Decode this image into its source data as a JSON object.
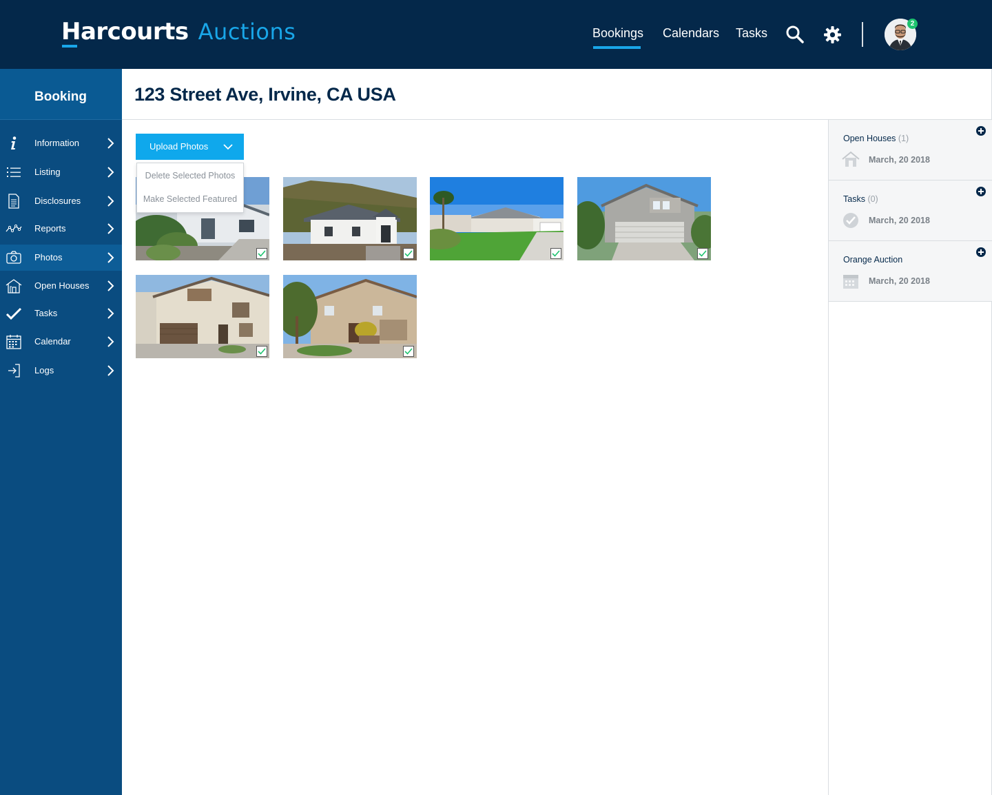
{
  "app": {
    "logo_main": "Harcourts",
    "logo_sub": "Auctions"
  },
  "topnav": {
    "items": [
      {
        "label": "Bookings",
        "active": true
      },
      {
        "label": "Calendars",
        "active": false
      },
      {
        "label": "Tasks",
        "active": false
      }
    ],
    "icons": [
      "search-icon",
      "gear-icon"
    ],
    "notification_count": "2",
    "accent_color": "#19a6e8"
  },
  "sidebar": {
    "title": "Booking",
    "items": [
      {
        "label": "Information",
        "icon": "info-icon"
      },
      {
        "label": "Listing",
        "icon": "list-icon"
      },
      {
        "label": "Disclosures",
        "icon": "document-icon"
      },
      {
        "label": "Reports",
        "icon": "chart-line-icon"
      },
      {
        "label": "Photos",
        "icon": "camera-icon",
        "active": true
      },
      {
        "label": "Open Houses",
        "icon": "house-icon"
      },
      {
        "label": "Tasks",
        "icon": "checkmark-icon"
      },
      {
        "label": "Calendar",
        "icon": "calendar-icon"
      },
      {
        "label": "Logs",
        "icon": "logout-icon"
      }
    ]
  },
  "page": {
    "title": "123 Street Ave, Irvine, CA USA"
  },
  "photos": {
    "upload_label": "Upload Photos",
    "menu": [
      "Delete Selected Photos",
      "Make Selected Featured"
    ],
    "items": [
      {
        "name": "photo-1",
        "checked": true
      },
      {
        "name": "photo-2",
        "checked": true
      },
      {
        "name": "photo-3",
        "checked": true
      },
      {
        "name": "photo-4",
        "checked": true
      },
      {
        "name": "photo-5",
        "checked": true
      },
      {
        "name": "photo-6",
        "checked": true
      }
    ]
  },
  "rightpanel": {
    "cards": [
      {
        "title": "Open Houses",
        "count": "(1)",
        "date": "March, 20 2018",
        "icon": "house-icon"
      },
      {
        "title": "Tasks",
        "count": "(0)",
        "date": "March, 20 2018",
        "icon": "check-circle-icon"
      },
      {
        "title": "Orange Auction",
        "count": "",
        "date": "March, 20 2018",
        "icon": "calendar-icon"
      }
    ]
  }
}
